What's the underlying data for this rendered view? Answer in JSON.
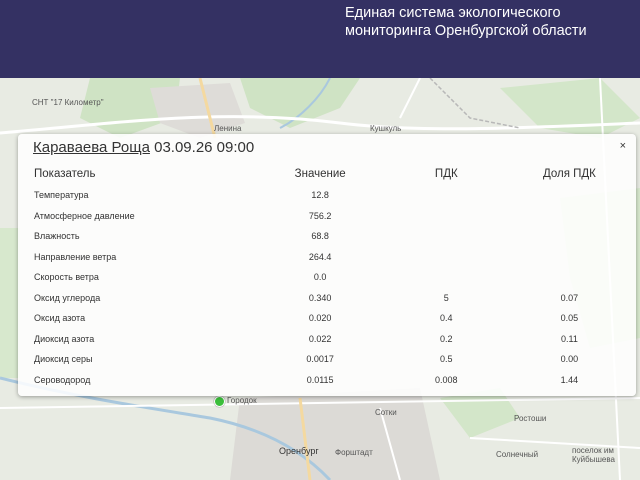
{
  "header": {
    "title": "Единая система экологического мониторинга Оренбургской области"
  },
  "map": {
    "labels": {
      "lenina": "Ленина",
      "kushkul": "Кушкуль",
      "snt": "СНТ \"17 Километр\"",
      "orenburg": "Оренбург",
      "forshtadt": "Форштадт",
      "sotki": "Сотки",
      "rostoshi": "Ростоши",
      "solnechny": "Солнечный",
      "kuybysheva": "поселок им Куйбышева",
      "gorodok": "Городок"
    }
  },
  "popup": {
    "station": "Караваева Роща",
    "datetime": "03.09.26 09:00",
    "close": "×",
    "columns": [
      "Показатель",
      "Значение",
      "ПДК",
      "Доля ПДК"
    ],
    "rows": [
      {
        "name": "Температура",
        "value": "12.8",
        "pdk": "",
        "share": ""
      },
      {
        "name": "Атмосферное давление",
        "value": "756.2",
        "pdk": "",
        "share": ""
      },
      {
        "name": "Влажность",
        "value": "68.8",
        "pdk": "",
        "share": ""
      },
      {
        "name": "Направление ветра",
        "value": "264.4",
        "pdk": "",
        "share": ""
      },
      {
        "name": "Скорость ветра",
        "value": "0.0",
        "pdk": "",
        "share": ""
      },
      {
        "name": "Оксид углерода",
        "value": "0.340",
        "pdk": "5",
        "share": "0.07"
      },
      {
        "name": "Оксид азота",
        "value": "0.020",
        "pdk": "0.4",
        "share": "0.05"
      },
      {
        "name": "Диоксид азота",
        "value": "0.022",
        "pdk": "0.2",
        "share": "0.11"
      },
      {
        "name": "Диоксид серы",
        "value": "0.0017",
        "pdk": "0.5",
        "share": "0.00"
      },
      {
        "name": "Сероводород",
        "value": "0.0115",
        "pdk": "0.008",
        "share": "1.44"
      }
    ]
  }
}
